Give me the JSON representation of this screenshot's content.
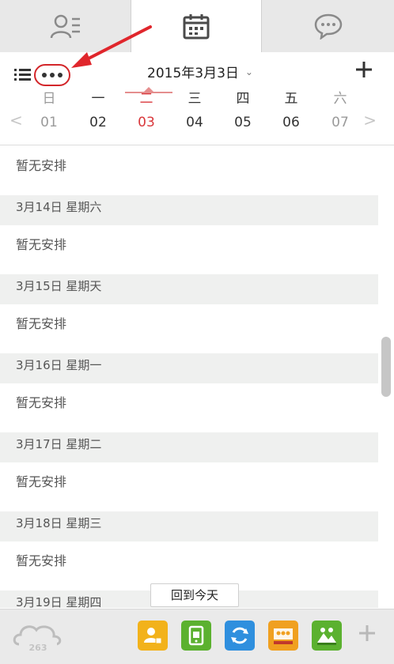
{
  "tabs": [
    {
      "name": "contacts",
      "icon": "contacts-icon"
    },
    {
      "name": "calendar",
      "icon": "calendar-icon",
      "active": true
    },
    {
      "name": "messages",
      "icon": "chat-bubble-icon"
    }
  ],
  "header": {
    "date_title": "2015年3月3日",
    "caret": "⌄"
  },
  "week": {
    "prev": "<",
    "next": ">",
    "days": [
      {
        "weekday": "日",
        "date": "01",
        "state": "muted"
      },
      {
        "weekday": "一",
        "date": "02",
        "state": "normal"
      },
      {
        "weekday": "二",
        "date": "03",
        "state": "active"
      },
      {
        "weekday": "三",
        "date": "04",
        "state": "normal"
      },
      {
        "weekday": "四",
        "date": "05",
        "state": "normal"
      },
      {
        "weekday": "五",
        "date": "06",
        "state": "normal"
      },
      {
        "weekday": "六",
        "date": "07",
        "state": "muted"
      }
    ]
  },
  "schedule": {
    "items": [
      {
        "type": "empty",
        "text": "暂无安排"
      },
      {
        "type": "date",
        "text": "3月14日 星期六"
      },
      {
        "type": "empty",
        "text": "暂无安排"
      },
      {
        "type": "date",
        "text": "3月15日 星期天"
      },
      {
        "type": "empty",
        "text": "暂无安排"
      },
      {
        "type": "date",
        "text": "3月16日 星期一"
      },
      {
        "type": "empty",
        "text": "暂无安排"
      },
      {
        "type": "date",
        "text": "3月17日 星期二"
      },
      {
        "type": "empty",
        "text": "暂无安排"
      },
      {
        "type": "date",
        "text": "3月18日 星期三"
      },
      {
        "type": "empty",
        "text": "暂无安排"
      },
      {
        "type": "date",
        "text": "3月19日 星期四"
      }
    ]
  },
  "today_button": "回到今天",
  "bottom_bar": {
    "brand_text": "263",
    "apps": [
      {
        "name": "contact-app-icon",
        "color": "#f2b21b"
      },
      {
        "name": "tablet-app-icon",
        "color": "#5bb12f"
      },
      {
        "name": "sync-app-icon",
        "color": "#2f8fde"
      },
      {
        "name": "meeting-app-icon",
        "color": "#f0a020"
      },
      {
        "name": "conference-app-icon",
        "color": "#5bb12f"
      }
    ]
  },
  "colors": {
    "accent_red": "#d9373b",
    "annotation_red": "#e0262c"
  }
}
